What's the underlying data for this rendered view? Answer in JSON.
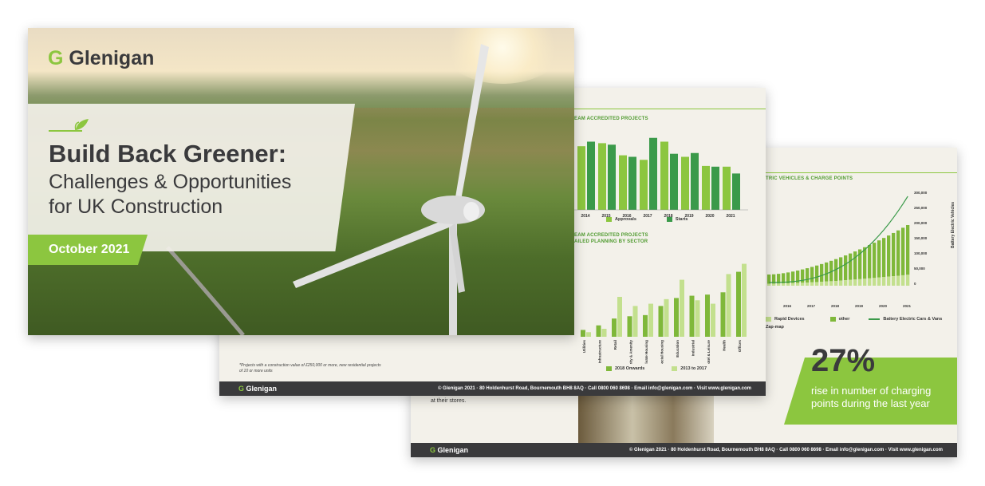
{
  "brand": {
    "name": "Glenigan",
    "green": "#8cc63f",
    "dark": "#3a3a3c"
  },
  "cover": {
    "title": "Build Back Greener:",
    "subtitle_line1": "Challenges & Opportunities",
    "subtitle_line2": "for UK Construction",
    "date": "October 2021"
  },
  "page2": {
    "section1_title": "EAM ACCREDITED PROJECTS",
    "section2_title_line1": "EAM ACCREDITED PROJECTS",
    "section2_title_line2": "AILED PLANNING BY SECTOR",
    "note": "*Projects with a construction value of £250,000 or more, new residential projects of 10 or more units",
    "footer_brand": "Glenigan",
    "footer_address": "© Glenigan 2021 · 80 Holdenhurst Road, Bournemouth BH8 8AQ · Call 0800 060 8698 · Email info@glenigan.com · Visit www.glenigan.com"
  },
  "page3": {
    "section_title": "TRIC VEHICLES & CHARGE POINTS",
    "stat_value": "27%",
    "stat_line1": "rise in number of charging",
    "stat_line2": "points during the last year",
    "text_fragment": "at their stores.",
    "legend_rapid": "Rapid Devices",
    "legend_other": "other",
    "legend_bev": "Battery Electric Cars & Vans",
    "legend_zapmap": "Zap-map",
    "y_axis_label": "Battery Electric Vehicles",
    "footer_brand": "Glenigan",
    "footer_address": "© Glenigan 2021 · 80 Holdenhurst Road, Bournemouth BH8 8AQ · Call 0800 060 8698 · Email info@glenigan.com · Visit www.glenigan.com"
  },
  "chart_data": [
    {
      "type": "bar",
      "categories": [
        "2014",
        "2015",
        "2016",
        "2017",
        "2018",
        "2019",
        "2020",
        "2021"
      ],
      "series": [
        {
          "name": "Approvals",
          "color": "#8cc63f",
          "values": [
            84,
            88,
            72,
            66,
            90,
            70,
            58,
            57
          ]
        },
        {
          "name": "Starts",
          "color": "#3a9a4a",
          "values": [
            90,
            86,
            70,
            95,
            74,
            75,
            57,
            48
          ]
        }
      ]
    },
    {
      "type": "bar",
      "categories": [
        "Utilities",
        "Infrastructure",
        "Retail",
        "Community & Amenity",
        "Private Housing",
        "Social Housing",
        "Education",
        "Industrial",
        "Hotel & Leisure",
        "Health",
        "Offices"
      ],
      "series": [
        {
          "name": "2018 Onwards",
          "color": "#7fb83a",
          "values": [
            6,
            10,
            16,
            18,
            19,
            27,
            34,
            36,
            37,
            39,
            57
          ]
        },
        {
          "name": "2013 to 2017",
          "color": "#c3e08e",
          "values": [
            4,
            7,
            35,
            27,
            29,
            33,
            50,
            32,
            29,
            55,
            64
          ]
        }
      ]
    },
    {
      "type": "bar",
      "categories": [
        "2016",
        "2017",
        "2018",
        "2019",
        "2020",
        "2021"
      ],
      "y_ticks": [
        "300,000",
        "250,000",
        "200,000",
        "150,000",
        "100,000",
        "50,000",
        "0"
      ],
      "series": [
        {
          "name": "other",
          "color": "#7fb83a"
        },
        {
          "name": "Rapid Devices",
          "color": "#c3e08e"
        },
        {
          "name": "Battery Electric Cars & Vans",
          "color": "#3a9a4a"
        }
      ]
    }
  ]
}
